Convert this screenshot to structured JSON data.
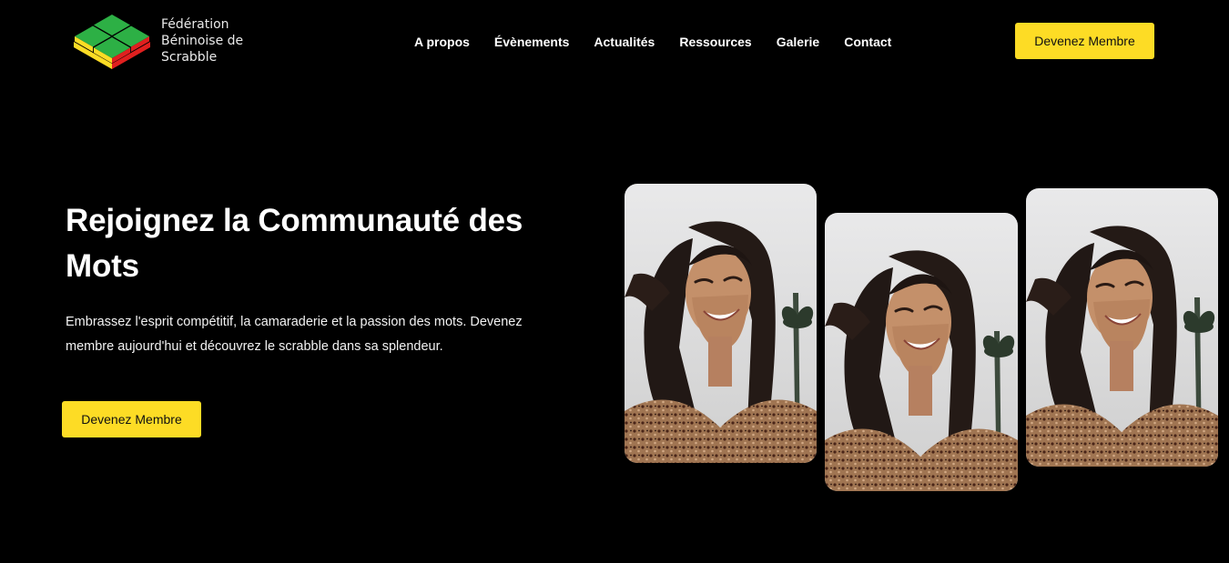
{
  "brand": {
    "name": "Fédération Béninoise de Scrabble",
    "colors": {
      "green": "#2db045",
      "yellow": "#fddc25",
      "red": "#e0201f",
      "button": "#fddc25",
      "background": "#000000"
    }
  },
  "nav": {
    "items": [
      {
        "label": "A propos"
      },
      {
        "label": "Évènements"
      },
      {
        "label": "Actualités"
      },
      {
        "label": "Ressources"
      },
      {
        "label": "Galerie"
      },
      {
        "label": "Contact"
      }
    ]
  },
  "header": {
    "cta_label": "Devenez Membre"
  },
  "hero": {
    "title": "Rejoignez la Communauté des Mots",
    "text": "Embrassez l'esprit compétitif, la camaraderie et la passion des mots. Devenez membre aujourd'hui et découvrez le scrabble dans sa splendeur.",
    "cta_label": "Devenez Membre"
  },
  "gallery": {
    "photos": [
      {
        "subject": "smiling-woman-photo"
      },
      {
        "subject": "smiling-woman-photo"
      },
      {
        "subject": "smiling-woman-photo"
      }
    ]
  }
}
